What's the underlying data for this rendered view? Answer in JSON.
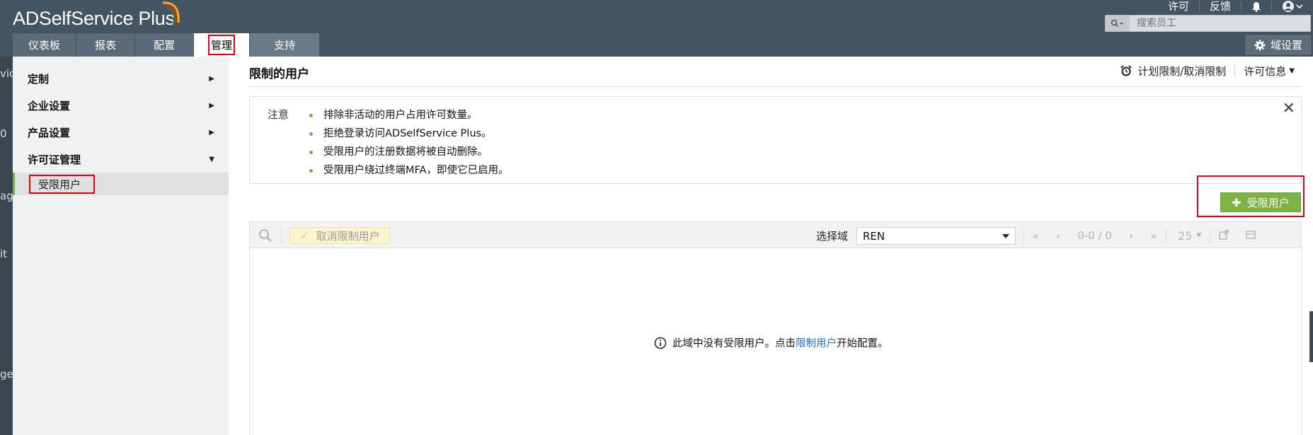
{
  "header": {
    "logo_text": "ADSelfService Plus",
    "top_links": [
      "许可",
      "反馈"
    ],
    "search_placeholder": "搜索员工",
    "domain_settings_label": "域设置"
  },
  "tabs": [
    {
      "label": "仪表板"
    },
    {
      "label": "报表"
    },
    {
      "label": "配置"
    },
    {
      "label": "管理"
    },
    {
      "label": "支持"
    }
  ],
  "left_strip": [
    "vic",
    "0",
    "ag",
    "it",
    "ge"
  ],
  "sidebar": {
    "items": [
      {
        "label": "定制"
      },
      {
        "label": "企业设置"
      },
      {
        "label": "产品设置"
      },
      {
        "label": "许可证管理"
      }
    ],
    "subitem": "受限用户"
  },
  "page": {
    "title": "限制的用户",
    "schedule_label": "计划限制/取消限制",
    "license_info_label": "许可信息"
  },
  "note": {
    "label": "注意",
    "items": [
      "排除非活动的用户占用许可数量。",
      "拒绝登录访问ADSelfService Plus。",
      "受限用户的注册数据将被自动删除。",
      "受限用户绕过终端MFA，即使它已启用。"
    ]
  },
  "add_button_label": "受限用户",
  "toolbar": {
    "unrestrict_label": "取消限制用户",
    "select_domain_label": "选择域",
    "selected_domain": "REN",
    "page_info": "0-0 / 0",
    "page_size": "25"
  },
  "empty": {
    "before": "此域中没有受限用户。点击",
    "link": "限制用户",
    "after": "开始配置。"
  },
  "colors": {
    "header_bg": "#445461",
    "accent_green": "#7bb440",
    "highlight_red": "#e60012",
    "link_blue": "#1a6fc4"
  }
}
